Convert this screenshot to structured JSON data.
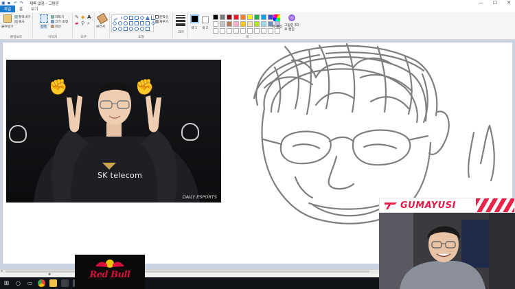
{
  "titlebar": {
    "title": "제목 없음 - 그림판",
    "window_buttons": [
      "—",
      "☐",
      "✕"
    ]
  },
  "ribbon_tabs": [
    "파일",
    "홈",
    "보기"
  ],
  "ribbon": {
    "clipboard": {
      "label": "클립보드",
      "paste": "붙여넣기",
      "cut": "잘라내기",
      "copy": "복사"
    },
    "image": {
      "label": "이미지",
      "select": "선택",
      "crop": "자르기",
      "resize": "크기 조정",
      "rotate": "회전"
    },
    "tools": {
      "label": "도구",
      "brushes": "브러시"
    },
    "shapes": {
      "label": "도형",
      "outline": "윤곽선",
      "fill": "채우기"
    },
    "size": {
      "label": "크기"
    },
    "colors": {
      "label": "색",
      "color1": "색 1",
      "color2": "색 2",
      "edit": "색 편집",
      "paint3d": "그림판 3D로 편집",
      "palette": [
        "#000000",
        "#7f7f7f",
        "#880015",
        "#ed1c24",
        "#ff7f27",
        "#fff200",
        "#22b14c",
        "#00a2e8",
        "#3f48cc",
        "#a349a4",
        "#ffffff",
        "#c3c3c3",
        "#b97a57",
        "#ffaec9",
        "#ffc90e",
        "#efe4b0",
        "#b5e61d",
        "#99d9ea",
        "#7092be",
        "#c8bfe7",
        "#ffffff",
        "#ffffff",
        "#ffffff",
        "#ffffff",
        "#ffffff",
        "#ffffff",
        "#ffffff",
        "#ffffff",
        "#ffffff",
        "#ffffff"
      ]
    }
  },
  "photo": {
    "brand": "SK telecom",
    "watermark": "DAILY ESPORTS"
  },
  "statusbar": {
    "marker": "✥"
  },
  "taskbar": {
    "icons": [
      "windows-icon",
      "search-icon",
      "task-view-icon",
      "chrome-icon",
      "explorer-icon",
      "store-icon",
      "paint-icon"
    ]
  },
  "overlays": {
    "sponsor": "Red Bull",
    "player_name": "GUMAYUSI"
  }
}
